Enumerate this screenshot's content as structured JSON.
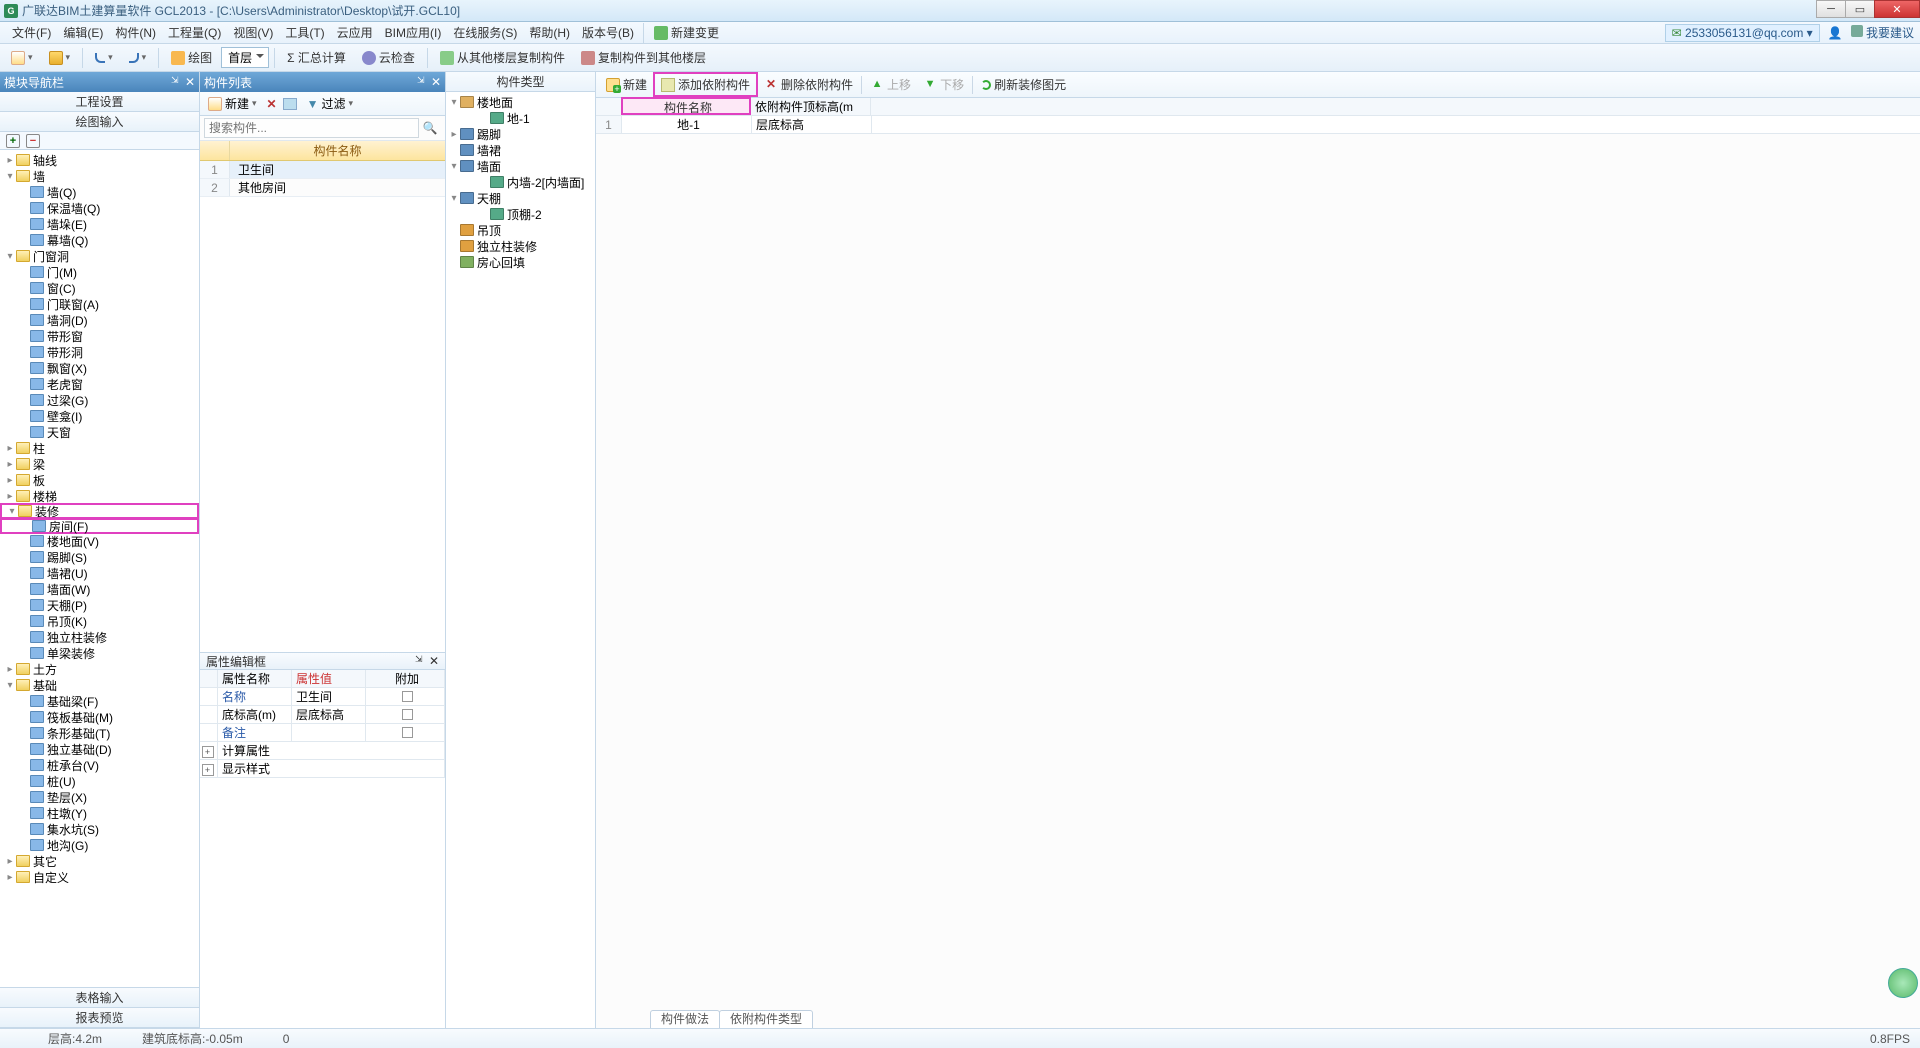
{
  "title": "广联达BIM土建算量软件 GCL2013 - [C:\\Users\\Administrator\\Desktop\\试开.GCL10]",
  "menubar": {
    "items": [
      "文件(F)",
      "编辑(E)",
      "构件(N)",
      "工程量(Q)",
      "视图(V)",
      "工具(T)",
      "云应用",
      "BIM应用(I)",
      "在线服务(S)",
      "帮助(H)",
      "版本号(B)"
    ],
    "newChange": "新建变更",
    "user": "2533056131@qq.com",
    "feedback": "我要建议"
  },
  "toolbar": {
    "draw": "绘图",
    "floor": "首层",
    "sum": "Σ 汇总计算",
    "cloud": "云检查",
    "copyFromOther": "从其他楼层复制构件",
    "copyToOther": "复制构件到其他楼层"
  },
  "navPanel": {
    "title": "模块导航栏",
    "tabs": {
      "engineering": "工程设置",
      "drawInput": "绘图输入"
    },
    "bottom": {
      "tableInput": "表格输入",
      "reportPreview": "报表预览"
    },
    "tree": [
      {
        "l": "轴线",
        "d": 0,
        "tw": "▸",
        "fold": true
      },
      {
        "l": "墙",
        "d": 0,
        "tw": "▾",
        "fold": true
      },
      {
        "l": "墙(Q)",
        "d": 1,
        "leaf": true
      },
      {
        "l": "保温墙(Q)",
        "d": 1,
        "leaf": true
      },
      {
        "l": "墙垛(E)",
        "d": 1,
        "leaf": true
      },
      {
        "l": "幕墙(Q)",
        "d": 1,
        "leaf": true
      },
      {
        "l": "门窗洞",
        "d": 0,
        "tw": "▾",
        "fold": true
      },
      {
        "l": "门(M)",
        "d": 1,
        "leaf": true
      },
      {
        "l": "窗(C)",
        "d": 1,
        "leaf": true
      },
      {
        "l": "门联窗(A)",
        "d": 1,
        "leaf": true
      },
      {
        "l": "墙洞(D)",
        "d": 1,
        "leaf": true
      },
      {
        "l": "带形窗",
        "d": 1,
        "leaf": true
      },
      {
        "l": "带形洞",
        "d": 1,
        "leaf": true
      },
      {
        "l": "飘窗(X)",
        "d": 1,
        "leaf": true
      },
      {
        "l": "老虎窗",
        "d": 1,
        "leaf": true
      },
      {
        "l": "过梁(G)",
        "d": 1,
        "leaf": true
      },
      {
        "l": "壁龛(I)",
        "d": 1,
        "leaf": true
      },
      {
        "l": "天窗",
        "d": 1,
        "leaf": true
      },
      {
        "l": "柱",
        "d": 0,
        "tw": "▸",
        "fold": true
      },
      {
        "l": "梁",
        "d": 0,
        "tw": "▸",
        "fold": true
      },
      {
        "l": "板",
        "d": 0,
        "tw": "▸",
        "fold": true
      },
      {
        "l": "楼梯",
        "d": 0,
        "tw": "▸",
        "fold": true
      },
      {
        "l": "装修",
        "d": 0,
        "tw": "▾",
        "fold": true,
        "magenta": true
      },
      {
        "l": "房间(F)",
        "d": 1,
        "leaf": true,
        "magenta": true
      },
      {
        "l": "楼地面(V)",
        "d": 1,
        "leaf": true
      },
      {
        "l": "踢脚(S)",
        "d": 1,
        "leaf": true
      },
      {
        "l": "墙裙(U)",
        "d": 1,
        "leaf": true
      },
      {
        "l": "墙面(W)",
        "d": 1,
        "leaf": true
      },
      {
        "l": "天棚(P)",
        "d": 1,
        "leaf": true
      },
      {
        "l": "吊顶(K)",
        "d": 1,
        "leaf": true
      },
      {
        "l": "独立柱装修",
        "d": 1,
        "leaf": true
      },
      {
        "l": "单梁装修",
        "d": 1,
        "leaf": true
      },
      {
        "l": "土方",
        "d": 0,
        "tw": "▸",
        "fold": true
      },
      {
        "l": "基础",
        "d": 0,
        "tw": "▾",
        "fold": true
      },
      {
        "l": "基础梁(F)",
        "d": 1,
        "leaf": true
      },
      {
        "l": "筏板基础(M)",
        "d": 1,
        "leaf": true
      },
      {
        "l": "条形基础(T)",
        "d": 1,
        "leaf": true
      },
      {
        "l": "独立基础(D)",
        "d": 1,
        "leaf": true
      },
      {
        "l": "桩承台(V)",
        "d": 1,
        "leaf": true
      },
      {
        "l": "桩(U)",
        "d": 1,
        "leaf": true
      },
      {
        "l": "垫层(X)",
        "d": 1,
        "leaf": true
      },
      {
        "l": "柱墩(Y)",
        "d": 1,
        "leaf": true
      },
      {
        "l": "集水坑(S)",
        "d": 1,
        "leaf": true
      },
      {
        "l": "地沟(G)",
        "d": 1,
        "leaf": true
      },
      {
        "l": "其它",
        "d": 0,
        "tw": "▸",
        "fold": true
      },
      {
        "l": "自定义",
        "d": 0,
        "tw": "▸",
        "fold": true
      }
    ]
  },
  "componentList": {
    "title": "构件列表",
    "toolbar": {
      "new": "新建",
      "filter": "过滤"
    },
    "searchPlaceholder": "搜索构件...",
    "header": "构件名称",
    "rows": [
      {
        "n": "1",
        "v": "卫生间",
        "sel": true
      },
      {
        "n": "2",
        "v": "其他房间"
      }
    ]
  },
  "propertyEditor": {
    "title": "属性编辑框",
    "headers": {
      "name": "属性名称",
      "val": "属性值",
      "add": "附加"
    },
    "rows": [
      {
        "name": "名称",
        "val": "卫生间",
        "link": true,
        "chk": false
      },
      {
        "name": "底标高(m)",
        "val": "层底标高",
        "chk": true
      },
      {
        "name": "备注",
        "val": "",
        "link": true,
        "chk": true
      }
    ],
    "expandRows": [
      "计算属性",
      "显示样式"
    ]
  },
  "componentType": {
    "title": "构件类型",
    "tree": [
      {
        "l": "楼地面",
        "d": 0,
        "tw": "▾",
        "ico": "#e0b060"
      },
      {
        "l": "地-1",
        "d": 2,
        "tw": "",
        "ico": "#5a8"
      },
      {
        "l": "踢脚",
        "d": 0,
        "tw": "▸",
        "ico": "#6090c0"
      },
      {
        "l": "墙裙",
        "d": 0,
        "tw": "",
        "ico": "#6090c0"
      },
      {
        "l": "墙面",
        "d": 0,
        "tw": "▾",
        "ico": "#6090c0"
      },
      {
        "l": "内墙-2[内墙面]",
        "d": 2,
        "tw": "",
        "ico": "#5a8"
      },
      {
        "l": "天棚",
        "d": 0,
        "tw": "▾",
        "ico": "#6090c0"
      },
      {
        "l": "顶棚-2",
        "d": 2,
        "tw": "",
        "ico": "#5a8"
      },
      {
        "l": "吊顶",
        "d": 0,
        "tw": "",
        "ico": "#e0a040"
      },
      {
        "l": "独立柱装修",
        "d": 0,
        "tw": "",
        "ico": "#e0a040"
      },
      {
        "l": "房心回填",
        "d": 0,
        "tw": "",
        "ico": "#80b060"
      }
    ]
  },
  "detail": {
    "toolbar": {
      "new": "新建",
      "addDep": "添加依附构件",
      "delDep": "删除依附构件",
      "up": "上移",
      "down": "下移",
      "refresh": "刷新装修图元"
    },
    "headers": {
      "name": "构件名称",
      "elev": "依附构件顶标高(m"
    },
    "rows": [
      {
        "n": "1",
        "name": "地-1",
        "elev": "层底标高"
      }
    ],
    "tabs": [
      "构件做法",
      "依附构件类型"
    ]
  },
  "status": {
    "floorH": "层高:4.2m",
    "baseElev": "建筑底标高:-0.05m",
    "zero": "0",
    "fps": "0.8FPS"
  }
}
